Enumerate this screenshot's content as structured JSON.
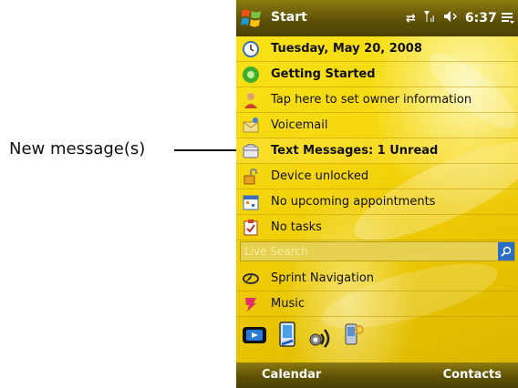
{
  "callout": {
    "text": "New message(s)"
  },
  "titlebar": {
    "start_label": "Start",
    "time": "6:37"
  },
  "today": {
    "items": [
      {
        "label": "Tuesday, May 20, 2008",
        "bold": true
      },
      {
        "label": "Getting Started",
        "bold": true
      },
      {
        "label": "Tap here to set owner information",
        "bold": false
      },
      {
        "label": "Voicemail",
        "bold": false
      },
      {
        "label": "Text Messages: 1 Unread",
        "bold": true
      },
      {
        "label": "Device unlocked",
        "bold": false
      },
      {
        "label": "No upcoming appointments",
        "bold": false
      },
      {
        "label": "No tasks",
        "bold": false
      }
    ],
    "search_placeholder": "Live Search",
    "apps": [
      {
        "label": "Sprint Navigation"
      },
      {
        "label": "Music"
      }
    ]
  },
  "softkeys": {
    "left": "Calendar",
    "right": "Contacts"
  },
  "colors": {
    "accent": "#f5d60e",
    "bar": "#5e5206"
  }
}
